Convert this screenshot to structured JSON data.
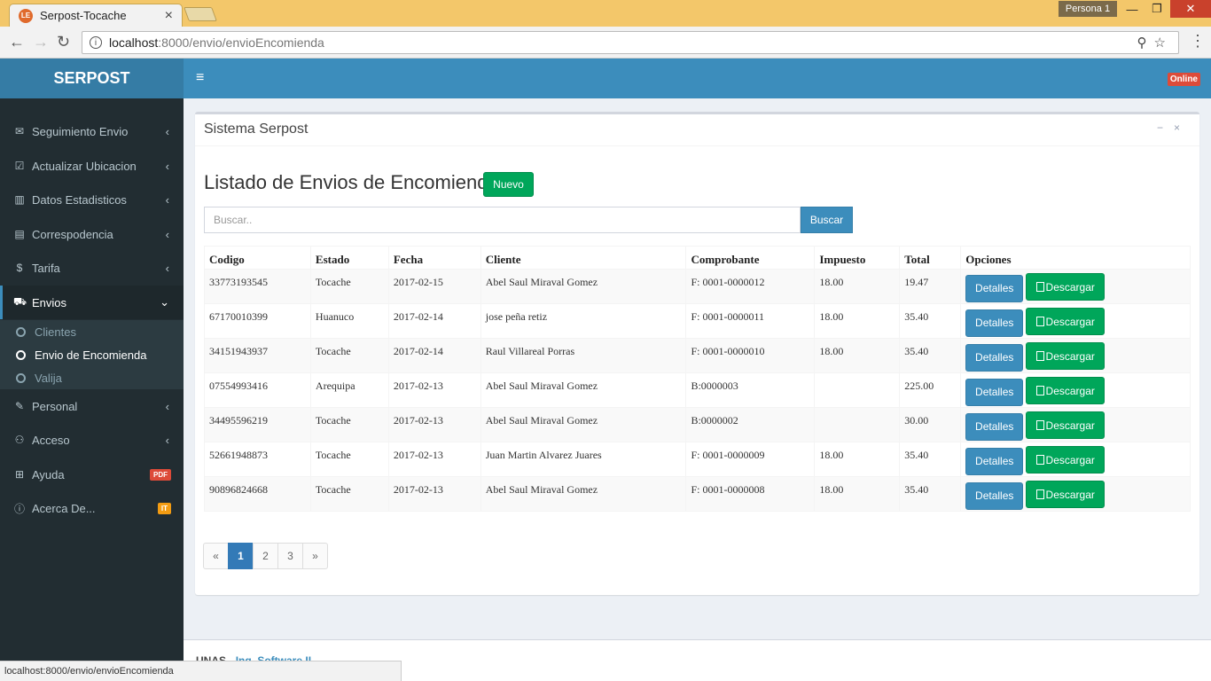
{
  "browser": {
    "tab_title": "Serpost-Tocache",
    "favicon_text": "LE",
    "profile": "Persona 1",
    "url_host": "localhost",
    "url_path": ":8000/envio/envioEncomienda",
    "status_url": "localhost:8000/envio/envioEncomienda"
  },
  "app": {
    "brand": "SERPOST",
    "online_badge": "Online"
  },
  "sidebar": {
    "items": [
      {
        "label": "Seguimiento Envio",
        "icon": "envelope-icon"
      },
      {
        "label": "Actualizar Ubicacion",
        "icon": "check-square-icon"
      },
      {
        "label": "Datos Estadisticos",
        "icon": "bar-chart-icon"
      },
      {
        "label": "Correspodencia",
        "icon": "list-alt-icon"
      },
      {
        "label": "Tarifa",
        "icon": "dollar-icon"
      },
      {
        "label": "Envios",
        "icon": "cart-icon"
      },
      {
        "label": "Personal",
        "icon": "edit-icon"
      },
      {
        "label": "Acceso",
        "icon": "users-icon"
      },
      {
        "label": "Ayuda",
        "icon": "plus-square-icon",
        "badge": "PDF",
        "badge_color": "#dd4b39"
      },
      {
        "label": "Acerca De...",
        "icon": "info-circle-icon",
        "badge": "IT",
        "badge_color": "#f39c12"
      }
    ],
    "submenu": [
      "Clientes",
      "Envio de Encomienda",
      "Valija"
    ]
  },
  "box": {
    "title": "Sistema Serpost",
    "heading": "Listado de Envios de Encomiendas",
    "new_button": "Nuevo",
    "search_placeholder": "Buscar..",
    "search_button": "Buscar"
  },
  "table": {
    "headers": [
      "Codigo",
      "Estado",
      "Fecha",
      "Cliente",
      "Comprobante",
      "Impuesto",
      "Total",
      "Opciones"
    ],
    "rows": [
      [
        "33773193545",
        "Tocache",
        "2017-02-15",
        "Abel Saul Miraval Gomez",
        "F: 0001-0000012",
        "18.00",
        "19.47"
      ],
      [
        "67170010399",
        "Huanuco",
        "2017-02-14",
        "jose peña retiz",
        "F: 0001-0000011",
        "18.00",
        "35.40"
      ],
      [
        "34151943937",
        "Tocache",
        "2017-02-14",
        "Raul Villareal Porras",
        "F: 0001-0000010",
        "18.00",
        "35.40"
      ],
      [
        "07554993416",
        "Arequipa",
        "2017-02-13",
        "Abel Saul Miraval Gomez",
        "B:0000003",
        "",
        "225.00"
      ],
      [
        "34495596219",
        "Tocache",
        "2017-02-13",
        "Abel Saul Miraval Gomez",
        "B:0000002",
        "",
        "30.00"
      ],
      [
        "52661948873",
        "Tocache",
        "2017-02-13",
        "Juan Martin Alvarez Juares",
        "F: 0001-0000009",
        "18.00",
        "35.40"
      ],
      [
        "90896824668",
        "Tocache",
        "2017-02-13",
        "Abel Saul Miraval Gomez",
        "F: 0001-0000008",
        "18.00",
        "35.40"
      ]
    ],
    "details_label": "Detalles",
    "download_label": "Descargar"
  },
  "pagination": [
    "«",
    "1",
    "2",
    "3",
    "»"
  ],
  "footer": {
    "org": "UNAS",
    "link": "Ing. Software II"
  },
  "colors": {
    "brand_dark": "#357ca5",
    "brand": "#3c8dbc",
    "success": "#00a65a",
    "sidebar": "#222d32"
  }
}
